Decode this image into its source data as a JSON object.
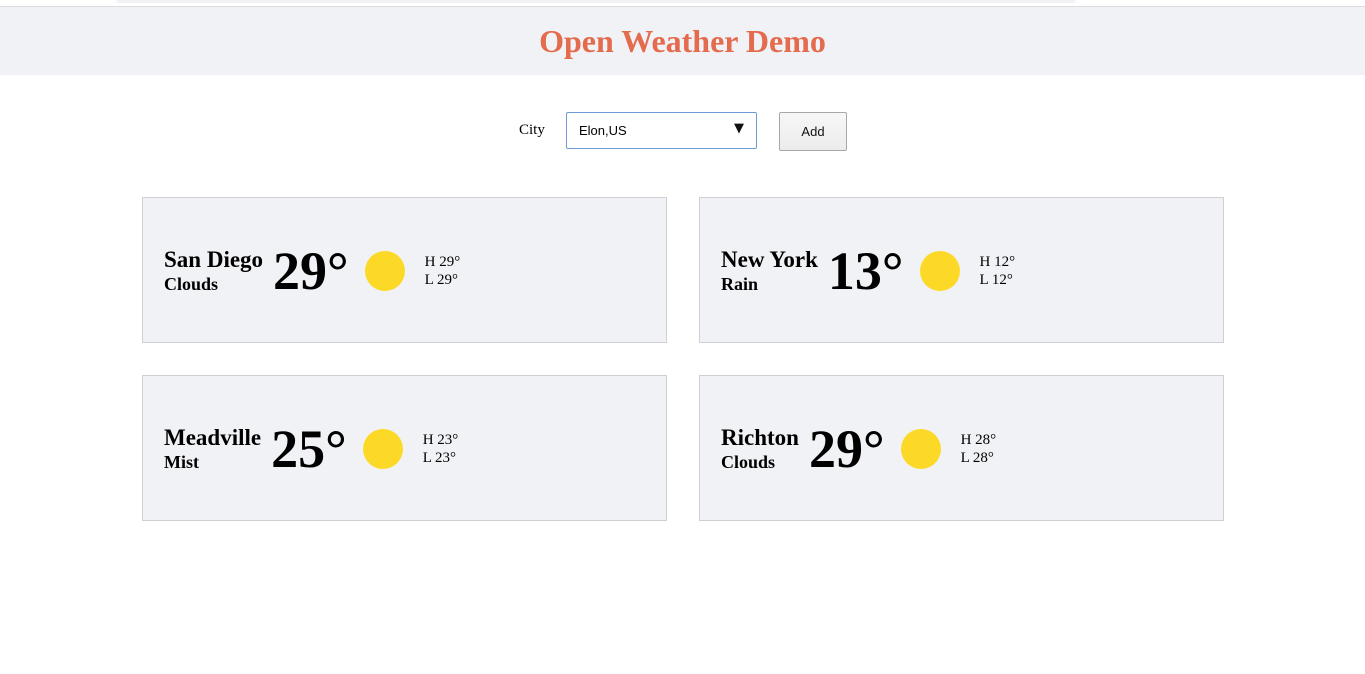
{
  "header": {
    "title": "Open Weather Demo"
  },
  "form": {
    "city_label": "City",
    "city_value": "Elon,US",
    "caret_glyph": "▼",
    "add_label": "Add"
  },
  "cards": [
    {
      "city": "San Diego",
      "condition": "Clouds",
      "temp": "29°",
      "high": "H 29°",
      "low": "L 29°",
      "icon": "sun-icon"
    },
    {
      "city": "New York",
      "condition": "Rain",
      "temp": "13°",
      "high": "H 12°",
      "low": "L 12°",
      "icon": "sun-icon"
    },
    {
      "city": "Meadville",
      "condition": "Mist",
      "temp": "25°",
      "high": "H 23°",
      "low": "L 23°",
      "icon": "sun-icon"
    },
    {
      "city": "Richton",
      "condition": "Clouds",
      "temp": "29°",
      "high": "H 28°",
      "low": "L 28°",
      "icon": "sun-icon"
    }
  ],
  "colors": {
    "title": "#e36b4e",
    "sun": "#fcd927",
    "card_bg": "#f1f2f5",
    "select_border": "#6d9ad6"
  }
}
